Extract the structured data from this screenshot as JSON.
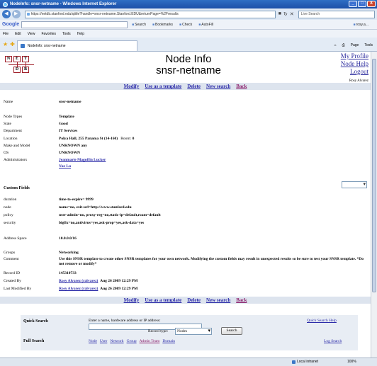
{
  "window": {
    "title": "NodeInfo: snsr-netname - Windows Internet Explorer",
    "url": "https://netdb.stanford.edu/qtitle?handle=snsr-netname.Stanford.EDU&returnPage=%2Fresults",
    "live_search_placeholder": "Live Search",
    "tab_label": "NodeInfo: snsr-netname",
    "buttons": {
      "minimize": "_",
      "maximize": "□",
      "close": "X"
    }
  },
  "google_toolbar": {
    "logo": "Google",
    "tools": [
      "Search",
      "Bookmarks",
      "Check",
      "AutoFill",
      "rosy.a..."
    ]
  },
  "menu": [
    "File",
    "Edit",
    "View",
    "Favorites",
    "Tools",
    "Help"
  ],
  "tab_tools": [
    "Page",
    "Tools"
  ],
  "logo_letters": {
    "n": "N",
    "e": "E",
    "t": "T",
    "d": "D",
    "b": "B"
  },
  "header": {
    "title": "Node Info",
    "subtitle": "snsr-netname"
  },
  "top_links": {
    "profile": "My Profile",
    "help": "Node Help",
    "logout": "Logout",
    "user": "Rosy Alvarez"
  },
  "actions": {
    "modify": "Modify",
    "template": "Use as a template",
    "delete": "Delete",
    "new_search": "New search",
    "back": "Back"
  },
  "fields": {
    "name": {
      "label": "Name",
      "value": "snsr-netname"
    },
    "node_types": {
      "label": "Node Types",
      "value": "Template"
    },
    "state": {
      "label": "State",
      "value": "Good"
    },
    "department": {
      "label": "Department",
      "value": "IT Services"
    },
    "location": {
      "label": "Location",
      "value": "Polya Hall, 255 Panama St (14-160)",
      "room_label": "Room:",
      "room": "0"
    },
    "make_model": {
      "label": "Make and Model",
      "value": "UNKNOWN any"
    },
    "os": {
      "label": "OS",
      "value": "UNKNOWN"
    },
    "administrators": {
      "label": "Administrators",
      "values": [
        "Jeanmarie Magoffin Lucker",
        "Yue Lu"
      ]
    },
    "custom_fields": {
      "label": "Custom Fields"
    },
    "duration": {
      "label": "duration",
      "value": "time-to-expire= 9999"
    },
    "node": {
      "label": "node",
      "value": "name=no, exit-url=http://www.stanford.edu"
    },
    "policy": {
      "label": "policy",
      "value": "user-admin=no, proxy-reg=no,static-ip=default,roam=default"
    },
    "security": {
      "label": "security",
      "value": "bigfix=no,antivirus=yes,ask-prop=yes,ask-data=yes"
    },
    "address_space": {
      "label": "Address Space",
      "value": "10.0.0.0/16"
    },
    "groups": {
      "label": "Groups",
      "value": "Networking"
    },
    "comment": {
      "label": "Comment",
      "value": "Use this SNSR template to create other SNSR templates for your own network. Modifying the custom fields may result in unexpected results so be sure to test your SNSR template. *Do not remove or modify*"
    },
    "record_id": {
      "label": "Record ID",
      "value": "145310733"
    },
    "created_by": {
      "label": "Created By",
      "user": "Rosy Alvarez (ralvarez)",
      "date": "Aug 26 2009 12:29 PM"
    },
    "modified_by": {
      "label": "Last Modified By",
      "user": "Rosy Alvarez (ralvarez)",
      "date": "Aug 26 2009 12:29 PM"
    }
  },
  "quick_search": {
    "label": "Quick Search",
    "prompt": "Enter a name, hardware address or IP address:",
    "record_type_label": "Record type:",
    "record_type_value": "Nodes",
    "search_button": "Search",
    "help_link": "Quick Search Help"
  },
  "full_search": {
    "label": "Full Search",
    "links": [
      "Node",
      "User",
      "Network",
      "Group",
      "Admin Team",
      "Domain"
    ],
    "log_link": "Log Search"
  },
  "status": {
    "zone": "Local intranet",
    "zoom": "100%"
  }
}
